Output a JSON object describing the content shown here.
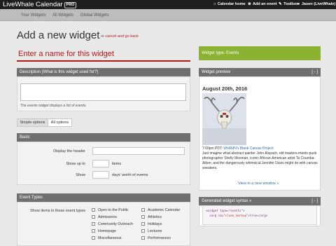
{
  "topbar": {
    "brand": "LiveWhale Calendar",
    "badge": "PRO",
    "links": [
      {
        "label": "Calendar home",
        "icon": "home-icon",
        "glyph": "⌂"
      },
      {
        "label": "Add an event",
        "icon": "plus-circle-icon",
        "glyph": "⊕"
      },
      {
        "label": "Toolbox",
        "icon": "wrench-icon",
        "glyph": "✎"
      },
      {
        "label": "Jason (LiveWhale)",
        "icon": "user-icon",
        "glyph": "●"
      }
    ]
  },
  "subnav": {
    "tabs": [
      "Your Widgets",
      "All Widgets",
      "Global Widgets"
    ]
  },
  "page": {
    "title": "Add a new widget",
    "cancel_prefix": "or",
    "cancel_link": "cancel and go back",
    "name_placeholder": "Enter a name for this widget"
  },
  "description": {
    "header": "Description (What is this widget used for?)",
    "helper": "The events widget displays a list of events."
  },
  "options_tabs": [
    "Simple options",
    "All options"
  ],
  "basic": {
    "header": "Basic",
    "display_header_label": "Display the header",
    "show_up_to_label": "Show up to",
    "show_up_to_suffix": "items",
    "show_label": "Show",
    "show_suffix": "days' worth of events"
  },
  "event_types": {
    "header": "Event Types",
    "label": "Show items in these event types",
    "col1": [
      "Open to the Public",
      "Admissions",
      "Community Outreach",
      "Homepage",
      "Miscellaneous"
    ],
    "col2": [
      "Academic Calendar",
      "Athletics",
      "Holidays",
      "Lectures",
      "Performances"
    ]
  },
  "right": {
    "type_bar": "Widget type:  Events",
    "preview_header": "Widget preview",
    "collapse_label": "[ - ]",
    "preview_date": "August 20th, 2016",
    "preview_time": "7:00pm PDT:",
    "preview_event": "WhAMN's Blank Canvas Project",
    "preview_desc": "Just imagine what abstract painter John Alspach, old masters-meets-punk photographer Shelly Mosman, iconic African-American artist Ta Coumba-Aiken, and the dangerously whimsical Jennifer Davis might do with canvas sneakers.",
    "view_link": "View in a new window »",
    "syntax_header": "Generated widget syntax »",
    "syntax_line1": "<widget type=\"events\">",
    "syntax_line2_a": "  <arg id=",
    "syntax_line2_b": "\"clean_markup\"",
    "syntax_line2_c": ">true</arg>"
  },
  "colors": {
    "accent_red": "#b31b1b",
    "accent_green": "#8cb234",
    "panel_header": "#6f6f6f",
    "link_blue": "#2a6fb5"
  }
}
